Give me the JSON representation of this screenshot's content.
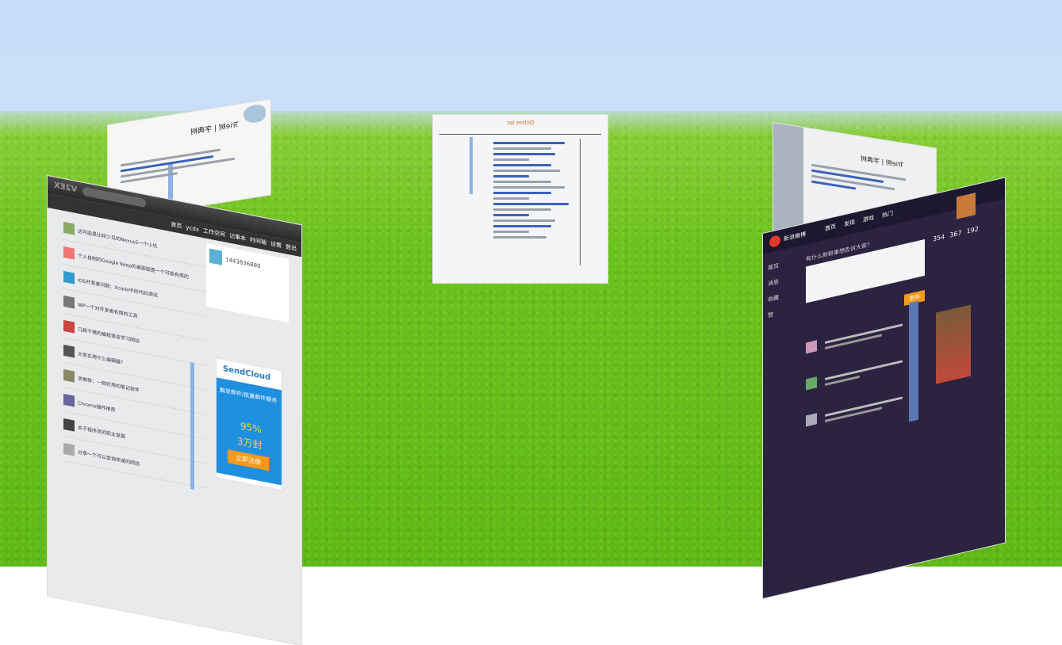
{
  "scene": {
    "sky_color": "#c6dcfb",
    "grass_color": "#6cc21c"
  },
  "center_panel": {
    "title": "Online lpc",
    "subtitle": ""
  },
  "left_back_panel": {
    "title": "Trie树 | 字典树"
  },
  "left_front_panel": {
    "logo": "V2EX",
    "nav": [
      "首页",
      "ycdx",
      "工作空间",
      "记事本",
      "时间轴",
      "设置",
      "登出"
    ],
    "user_id": "1443836880",
    "promo_brand": "SendCloud",
    "promo_line1": "触发邮件/批量邮件服务",
    "promo_discount": "95%",
    "promo_amount": "3万封",
    "promo_button": "立即注册",
    "topics": [
      "这可能是比较少见的Nexus5一个小坑",
      "个人自制的Google Keep的桌面版是一个可能有用的",
      "iOS开发者问题：Xcode中的代码调试",
      "WP一个对开发者有用的工具",
      "几款不错的编程语言学习网站",
      "大家在用什么编辑器？",
      "求推荐：一款好用的笔记软件",
      "Chrome插件推荐",
      "关于程序员的职业发展",
      "分享一个可以查询快递的网站"
    ]
  },
  "right_back_panel": {
    "title": "Trie树 | 字典树"
  },
  "right_front_panel": {
    "brand": "新浪微博",
    "nav": [
      "首页",
      "发现",
      "游戏",
      "热门"
    ],
    "sidebar": [
      "首页",
      "消息",
      "收藏",
      "赞"
    ],
    "compose_label": "有什么新鲜事想告诉大家？",
    "stats": [
      "354",
      "367",
      "192"
    ],
    "publish_button": "发布"
  }
}
